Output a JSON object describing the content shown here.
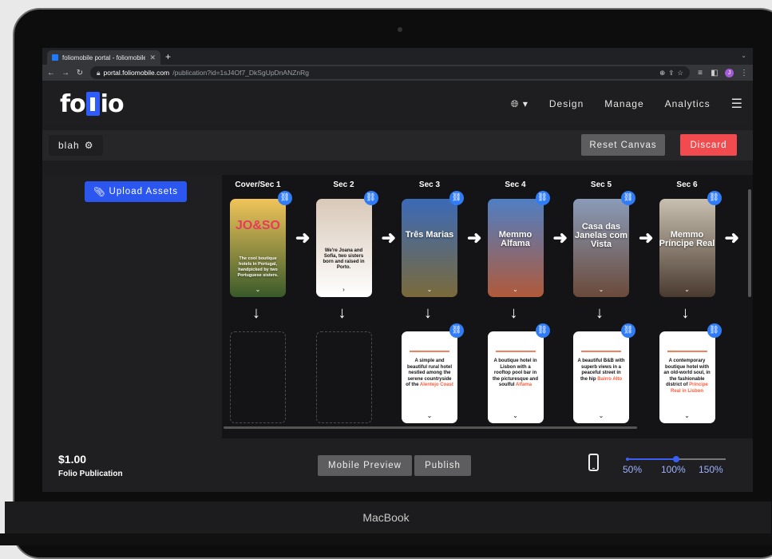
{
  "device": {
    "brand": "MacBook"
  },
  "browser": {
    "tab_title": "foliomobile portal - foliomobile",
    "url_host": "portal.foliomobile.com",
    "url_path": "/publication?id=1sJ4Of7_DkSgUpDnANZnRg",
    "avatar_initial": "J"
  },
  "header": {
    "logo_left": "fo",
    "logo_right": "io",
    "nav": [
      "Design",
      "Manage",
      "Analytics"
    ]
  },
  "toolbar": {
    "publication_name": "blah",
    "reset_label": "Reset Canvas",
    "discard_label": "Discard"
  },
  "left_panel": {
    "upload_label": "Upload Assets"
  },
  "canvas": {
    "columns": [
      {
        "label": "Cover/Sec 1",
        "cover_title": "JO&SO",
        "cover_caption": "The cool boutique hotels in Portugal, handpicked by two Portuguese sisters.",
        "cover_top": "#f0c45a",
        "cover_bottom": "#3a5a2a",
        "has_sub": false
      },
      {
        "label": "Sec 2",
        "cover_title": "We're Joana and Sofia, two sisters born and raised in Porto.",
        "cover_top": "#d8c8b8",
        "cover_bottom": "#ffffff",
        "has_sub": false
      },
      {
        "label": "Sec 3",
        "cover_title": "Três Marias",
        "cover_top": "#3b6ab8",
        "cover_bottom": "#7a6a3a",
        "has_sub": true,
        "sub_text": "A simple and beautiful rural hotel nestled among the serene countryside of the",
        "sub_highlight": "Alentejo Coast"
      },
      {
        "label": "Sec 4",
        "cover_title": "Memmo Alfama",
        "cover_top": "#4f7fc4",
        "cover_bottom": "#b05a3a",
        "has_sub": true,
        "sub_text": "A boutique hotel in Lisbon with a rooftop pool bar in the picturesque and soulful",
        "sub_highlight": "Alfama"
      },
      {
        "label": "Sec 5",
        "cover_title": "Casa das Janelas com Vista",
        "cover_top": "#8a9bb8",
        "cover_bottom": "#6a4a3a",
        "has_sub": true,
        "sub_text": "A beautiful B&B with superb views in a peaceful street in the hip",
        "sub_highlight": "Bairro Alto"
      },
      {
        "label": "Sec 6",
        "cover_title": "Memmo Príncipe Real",
        "cover_top": "#c8c0b0",
        "cover_bottom": "#4a3a30",
        "has_sub": true,
        "sub_text": "A contemporary boutique hotel with an old-world soul, in the fashionable district of",
        "sub_highlight": "Príncipe Real in Lisbon"
      }
    ]
  },
  "footer": {
    "price": "$1.00",
    "publication_label": "Folio Publication",
    "mobile_preview_label": "Mobile Preview",
    "publish_label": "Publish",
    "zoom": {
      "value_percent": 100,
      "min_percent": 50,
      "max_percent": 150,
      "labels": [
        "50%",
        "100%",
        "150%"
      ]
    }
  },
  "colors": {
    "accent": "#2f5cff",
    "danger": "#f14a4f",
    "link": "#2f7cf6"
  }
}
